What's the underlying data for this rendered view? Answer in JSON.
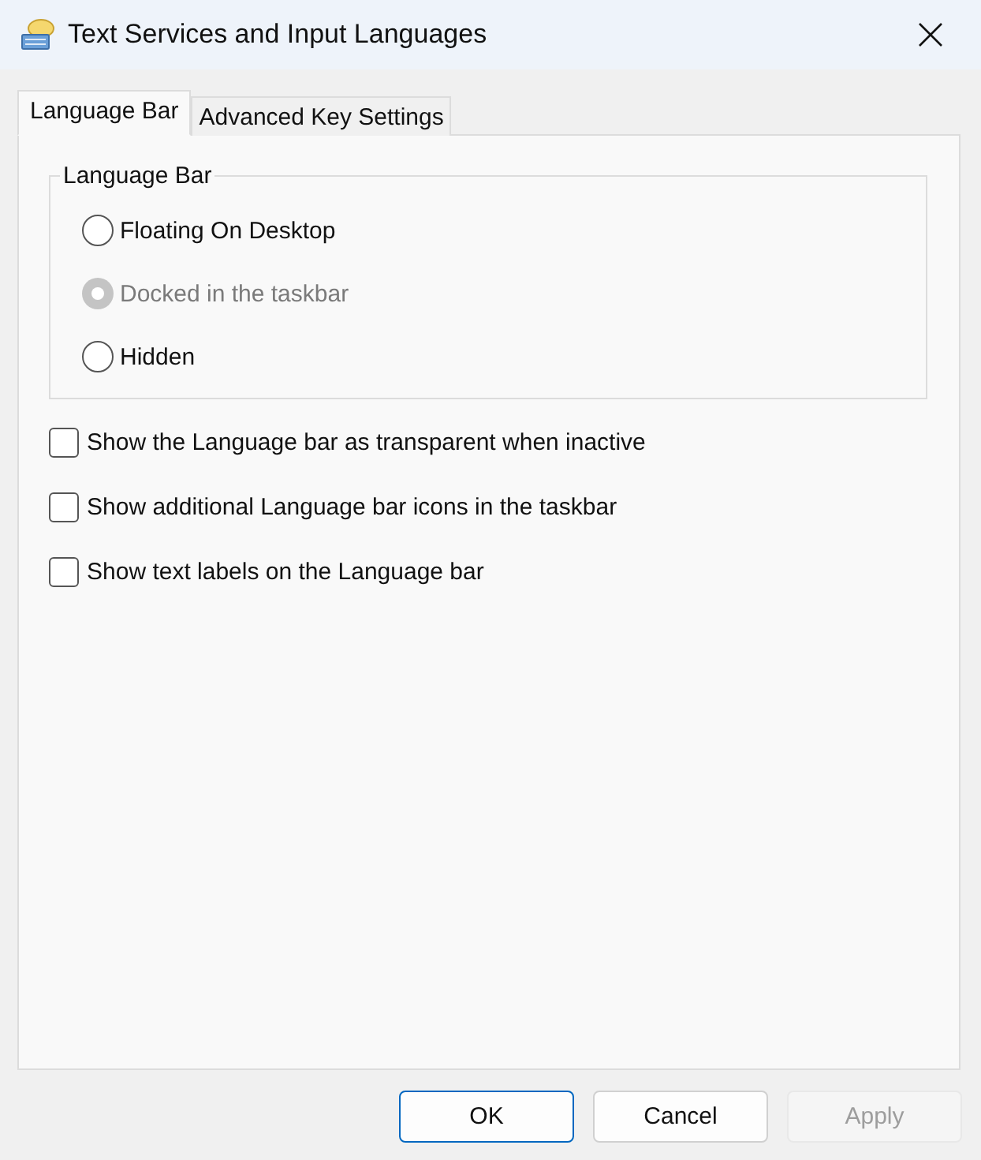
{
  "window": {
    "title": "Text Services and Input Languages"
  },
  "tabs": [
    {
      "label": "Language Bar",
      "selected": true
    },
    {
      "label": "Advanced Key Settings",
      "selected": false
    }
  ],
  "group": {
    "title": "Language Bar",
    "options": [
      {
        "label": "Floating On Desktop",
        "selected": false,
        "disabled": false
      },
      {
        "label": "Docked in the taskbar",
        "selected": true,
        "disabled": true
      },
      {
        "label": "Hidden",
        "selected": false,
        "disabled": false
      }
    ]
  },
  "checkboxes": [
    {
      "label": "Show the Language bar as transparent when inactive",
      "checked": false
    },
    {
      "label": "Show additional Language bar icons in the taskbar",
      "checked": false
    },
    {
      "label": "Show text labels on the Language bar",
      "checked": false
    }
  ],
  "buttons": [
    {
      "label": "OK",
      "kind": "default",
      "disabled": false
    },
    {
      "label": "Cancel",
      "kind": "normal",
      "disabled": false
    },
    {
      "label": "Apply",
      "kind": "normal",
      "disabled": true
    }
  ]
}
